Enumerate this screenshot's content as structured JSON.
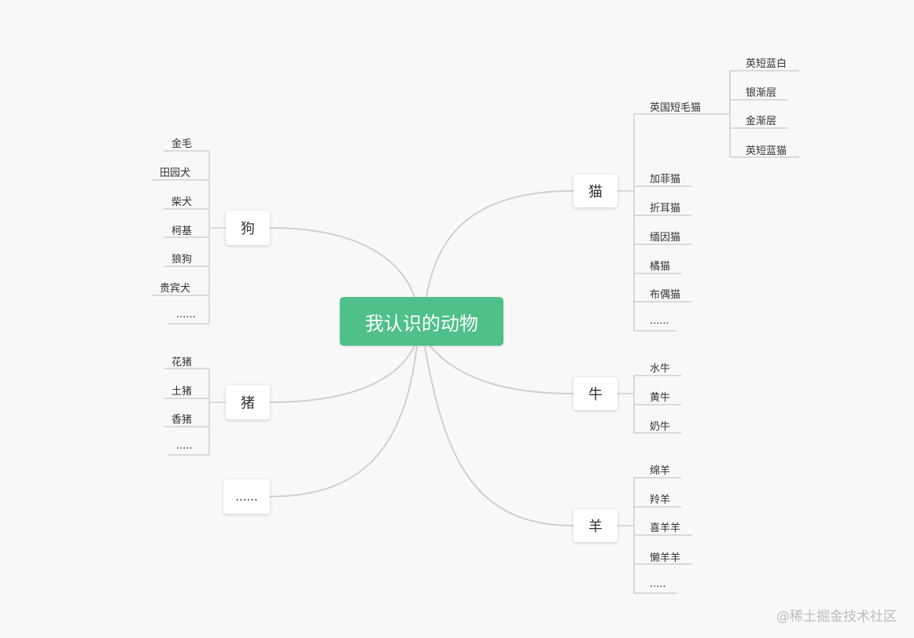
{
  "root": {
    "label": "我认识的动物"
  },
  "branches": {
    "dog": {
      "label": "狗",
      "children": [
        "金毛",
        "田园犬",
        "柴犬",
        "柯基",
        "狼狗",
        "贵宾犬",
        "......"
      ]
    },
    "pig": {
      "label": "猪",
      "children": [
        "花猪",
        "土猪",
        "香猪",
        "....."
      ]
    },
    "more": {
      "label": "......"
    },
    "cat": {
      "label": "猫",
      "children": [
        "英国短毛猫",
        "加菲猫",
        "折耳猫",
        "缅因猫",
        "橘猫",
        "布偶猫",
        "......"
      ],
      "british_shorthair": {
        "label": "英国短毛猫",
        "children": [
          "英短蓝白",
          "银渐层",
          "金渐层",
          "英短蓝猫"
        ]
      }
    },
    "cow": {
      "label": "牛",
      "children": [
        "水牛",
        "黄牛",
        "奶牛"
      ]
    },
    "sheep": {
      "label": "羊",
      "children": [
        "绵羊",
        "羚羊",
        "喜羊羊",
        "懒羊羊",
        "....."
      ]
    }
  },
  "watermark": "@稀土掘金技术社区",
  "colors": {
    "root_bg": "#4fc089",
    "line": "#cfcfcf",
    "background": "#f8f8f8"
  }
}
